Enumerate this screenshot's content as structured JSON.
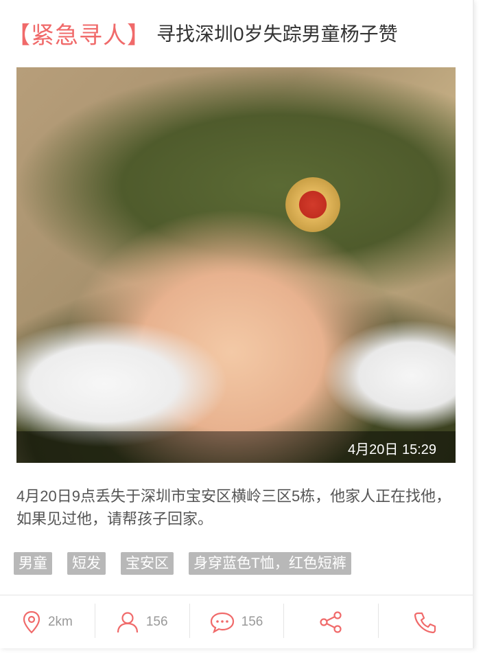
{
  "title": {
    "tag": "【紧急寻人】",
    "text": "寻找深圳0岁失踪男童杨子赞"
  },
  "photo": {
    "timestamp": "4月20日 15:29"
  },
  "description": "4月20日9点丢失于深圳市宝安区横岭三区5栋，他家人正在找他，如果见过他，请帮孩子回家。",
  "tags": [
    "男童",
    "短发",
    "宝安区",
    "身穿蓝色T恤，红色短裤"
  ],
  "actions": {
    "location": {
      "icon": "location-pin-icon",
      "label": "2km"
    },
    "followers": {
      "icon": "person-icon",
      "label": "156"
    },
    "comments": {
      "icon": "comment-bubble-icon",
      "label": "156"
    },
    "share": {
      "icon": "share-icon"
    },
    "phone": {
      "icon": "phone-icon"
    }
  },
  "colors": {
    "accent": "#f06a6a",
    "tag_bg": "#b8b8b8",
    "text": "#333333"
  }
}
